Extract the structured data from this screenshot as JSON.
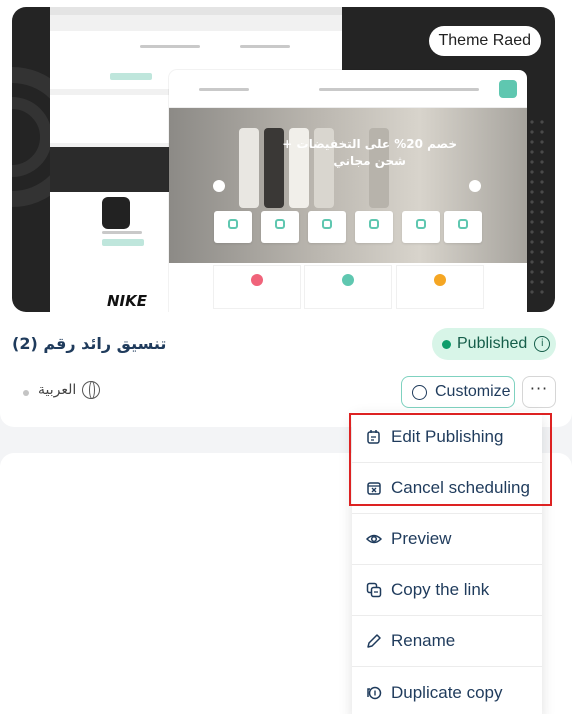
{
  "theme_card": {
    "preview_badge": "Theme Raed",
    "hero_text_line1": "خصم 20% على التخفيضات +",
    "hero_text_line2": "شحن مجاني",
    "brand_logo_text": "NIKE",
    "title": "تنسيق رائد رقم (2)",
    "status_label": "Published",
    "language": "العربية",
    "customize_label": "Customize",
    "more_label": "···"
  },
  "dropdown": {
    "items": [
      {
        "label": "Edit Publishing",
        "icon": "edit-publishing-icon"
      },
      {
        "label": "Cancel scheduling",
        "icon": "calendar-x-icon"
      },
      {
        "label": "Preview",
        "icon": "eye-icon"
      },
      {
        "label": "Copy the link",
        "icon": "copy-link-icon"
      },
      {
        "label": "Rename",
        "icon": "pencil-icon"
      },
      {
        "label": "Duplicate copy",
        "icon": "duplicate-icon"
      }
    ]
  },
  "colors": {
    "accent": "#5fc7b0",
    "published_bg": "#d8f5e8",
    "published_text": "#155e4a",
    "highlight_border": "#dd2222"
  }
}
